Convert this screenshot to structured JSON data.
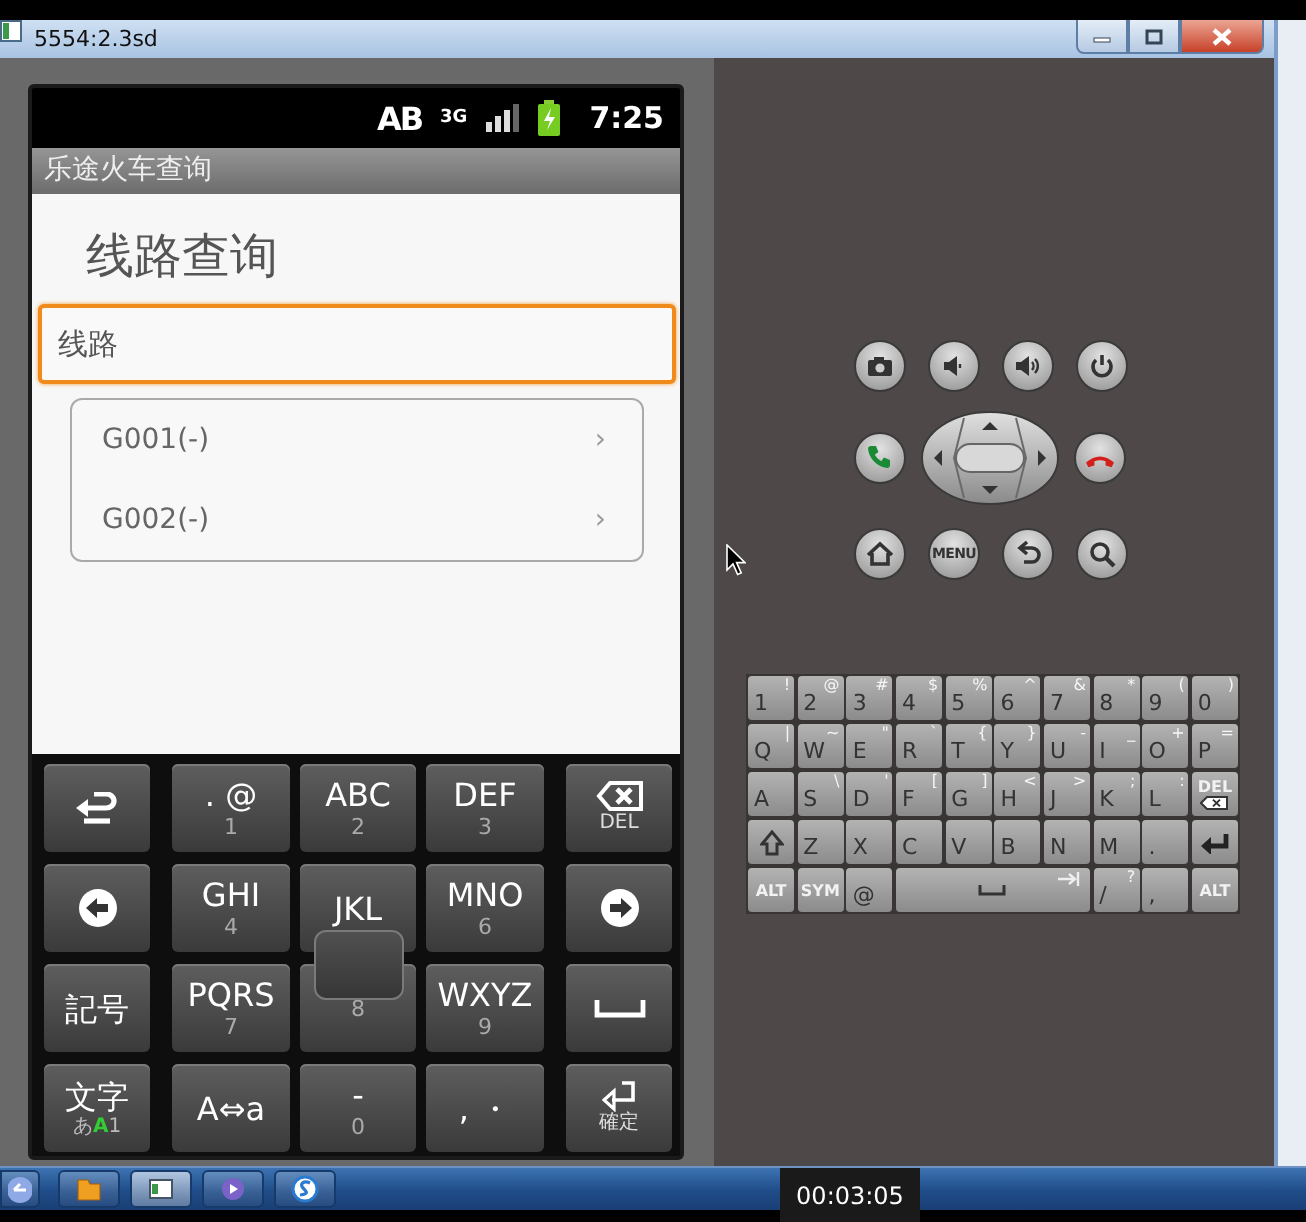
{
  "window": {
    "title": "5554:2.3sd",
    "controls": [
      {
        "kind": "minimize"
      },
      {
        "kind": "maximize"
      },
      {
        "kind": "close"
      }
    ]
  },
  "status_bar": {
    "input_badge": "AB",
    "network": "3G",
    "time": "7:25"
  },
  "app": {
    "title": "乐途火车查询",
    "heading": "线路查询",
    "search_field": {
      "value": "线路",
      "focused": true
    },
    "routes": [
      {
        "label": "G001(-)",
        "chevron": "›"
      },
      {
        "label": "G002(-)",
        "chevron": "›"
      }
    ]
  },
  "soft_keyboard": {
    "rows": [
      [
        {
          "kind": "undo",
          "pressed": false
        },
        {
          "kind": "text",
          "label": ". @",
          "sub": "1",
          "pressed": false
        },
        {
          "kind": "text",
          "label": "ABC",
          "sub": "2",
          "pressed": false
        },
        {
          "kind": "text",
          "label": "DEF",
          "sub": "3",
          "pressed": false
        },
        {
          "kind": "delete",
          "label": "DEL",
          "pressed": false
        }
      ],
      [
        {
          "kind": "left",
          "pressed": false
        },
        {
          "kind": "text",
          "label": "GHI",
          "sub": "4",
          "pressed": false
        },
        {
          "kind": "text",
          "label": "JKL",
          "pressed": false
        },
        {
          "kind": "text",
          "label": "MNO",
          "sub": "6",
          "pressed": false
        },
        {
          "kind": "right",
          "pressed": false
        }
      ],
      [
        {
          "kind": "text",
          "label": "記号",
          "pressed": false
        },
        {
          "kind": "text",
          "label": "PQRS",
          "sub": "7",
          "pressed": false
        },
        {
          "kind": "text",
          "sub": "8",
          "pressed": true
        },
        {
          "kind": "text",
          "label": "WXYZ",
          "sub": "9",
          "pressed": false
        },
        {
          "kind": "space",
          "pressed": false
        }
      ],
      [
        {
          "kind": "mode",
          "label": "文字",
          "modes": [
            {
              "text": "あ",
              "selected": false
            },
            {
              "text": "A",
              "selected": true
            },
            {
              "text": "1",
              "selected": false
            }
          ],
          "pressed": false
        },
        {
          "kind": "text",
          "label": "A⇔a",
          "pressed": false
        },
        {
          "kind": "text",
          "label": "-",
          "sub": "0",
          "pressed": false
        },
        {
          "kind": "text",
          "label": ",  ・",
          "pressed": false
        },
        {
          "kind": "enter",
          "label": "確定",
          "pressed": false
        }
      ]
    ]
  },
  "hardware_keys": {
    "rows": [
      [
        {
          "kind": "camera"
        },
        {
          "kind": "volume-down"
        },
        {
          "kind": "volume-up"
        },
        {
          "kind": "power"
        }
      ],
      [
        {
          "kind": "call"
        },
        {
          "kind": "dpad"
        },
        {
          "kind": "end-call"
        }
      ],
      [
        {
          "kind": "home"
        },
        {
          "kind": "menu",
          "label": "MENU"
        },
        {
          "kind": "back"
        },
        {
          "kind": "search"
        }
      ]
    ]
  },
  "qwerty_keyboard": {
    "rows": [
      [
        {
          "kind": "char",
          "label": "1",
          "alt": "!"
        },
        {
          "kind": "char",
          "label": "2",
          "alt": "@"
        },
        {
          "kind": "char",
          "label": "3",
          "alt": "#"
        },
        {
          "kind": "char",
          "label": "4",
          "alt": "$"
        },
        {
          "kind": "char",
          "label": "5",
          "alt": "%"
        },
        {
          "kind": "char",
          "label": "6",
          "alt": "^"
        },
        {
          "kind": "char",
          "label": "7",
          "alt": "&"
        },
        {
          "kind": "char",
          "label": "8",
          "alt": "*"
        },
        {
          "kind": "char",
          "label": "9",
          "alt": "("
        },
        {
          "kind": "char",
          "label": "0",
          "alt": ")"
        }
      ],
      [
        {
          "kind": "char",
          "label": "Q",
          "alt": "|"
        },
        {
          "kind": "char",
          "label": "W",
          "alt": "~"
        },
        {
          "kind": "char",
          "label": "E",
          "alt": "\""
        },
        {
          "kind": "char",
          "label": "R",
          "alt": "`"
        },
        {
          "kind": "char",
          "label": "T",
          "alt": "{"
        },
        {
          "kind": "char",
          "label": "Y",
          "alt": "}"
        },
        {
          "kind": "char",
          "label": "U",
          "alt": "-"
        },
        {
          "kind": "char",
          "label": "I",
          "alt": "_"
        },
        {
          "kind": "char",
          "label": "O",
          "alt": "+"
        },
        {
          "kind": "char",
          "label": "P",
          "alt": "="
        }
      ],
      [
        {
          "kind": "char",
          "label": "A"
        },
        {
          "kind": "char",
          "label": "S",
          "alt": "\\"
        },
        {
          "kind": "char",
          "label": "D",
          "alt": "'"
        },
        {
          "kind": "char",
          "label": "F",
          "alt": "["
        },
        {
          "kind": "char",
          "label": "G",
          "alt": "]"
        },
        {
          "kind": "char",
          "label": "H",
          "alt": "<"
        },
        {
          "kind": "char",
          "label": "J",
          "alt": ">"
        },
        {
          "kind": "char",
          "label": "K",
          "alt": ";"
        },
        {
          "kind": "char",
          "label": "L",
          "alt": ":"
        },
        {
          "kind": "del",
          "label": "DEL"
        }
      ],
      [
        {
          "kind": "shift"
        },
        {
          "kind": "char",
          "label": "Z"
        },
        {
          "kind": "char",
          "label": "X"
        },
        {
          "kind": "char",
          "label": "C"
        },
        {
          "kind": "char",
          "label": "V"
        },
        {
          "kind": "char",
          "label": "B"
        },
        {
          "kind": "char",
          "label": "N"
        },
        {
          "kind": "char",
          "label": "M"
        },
        {
          "kind": "char",
          "label": "."
        },
        {
          "kind": "enter"
        }
      ]
    ],
    "bottom_row": [
      {
        "kind": "mod",
        "label": "ALT"
      },
      {
        "kind": "mod",
        "label": "SYM"
      },
      {
        "kind": "char",
        "label": "@"
      },
      {
        "kind": "space"
      },
      {
        "kind": "char",
        "label": "/",
        "alt": "?"
      },
      {
        "kind": "char",
        "label": ","
      },
      {
        "kind": "mod",
        "label": "ALT"
      }
    ]
  },
  "taskbar": {
    "buttons": [
      {
        "kind": "start",
        "selected": false
      },
      {
        "kind": "folder",
        "selected": false
      },
      {
        "kind": "window",
        "selected": true
      },
      {
        "kind": "media",
        "selected": false
      },
      {
        "kind": "sogou",
        "selected": false
      }
    ]
  },
  "recording_timer": "00:03:05"
}
